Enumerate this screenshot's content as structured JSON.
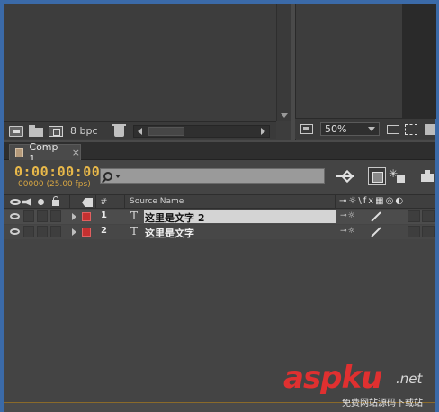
{
  "project_panel": {
    "bit_depth": "8 bpc"
  },
  "viewer": {
    "zoom": "50%"
  },
  "timeline": {
    "tab_label": "Comp 1",
    "tab_close": "×",
    "timecode": "0:00:00:00",
    "frames": "00000 (25.00 fps)",
    "columns": {
      "hash": "#",
      "source_name": "Source Name",
      "switches": "⊸☼\\fx▦◎◐"
    },
    "layers": [
      {
        "number": "1",
        "type_glyph": "T",
        "name": "这里是文字 2",
        "switches": "⊸☼",
        "label_color": "#c43030"
      },
      {
        "number": "2",
        "type_glyph": "T",
        "name": "这里是文字",
        "switches": "⊸☼",
        "label_color": "#c43030"
      }
    ]
  },
  "watermark": {
    "brand": "aspku",
    "domain_suffix": ".net",
    "subtitle": "免费网站源码下载站"
  },
  "colors": {
    "timecode": "#e8b84a",
    "label_red": "#c43030",
    "frame_blue": "#3b6aa8"
  }
}
